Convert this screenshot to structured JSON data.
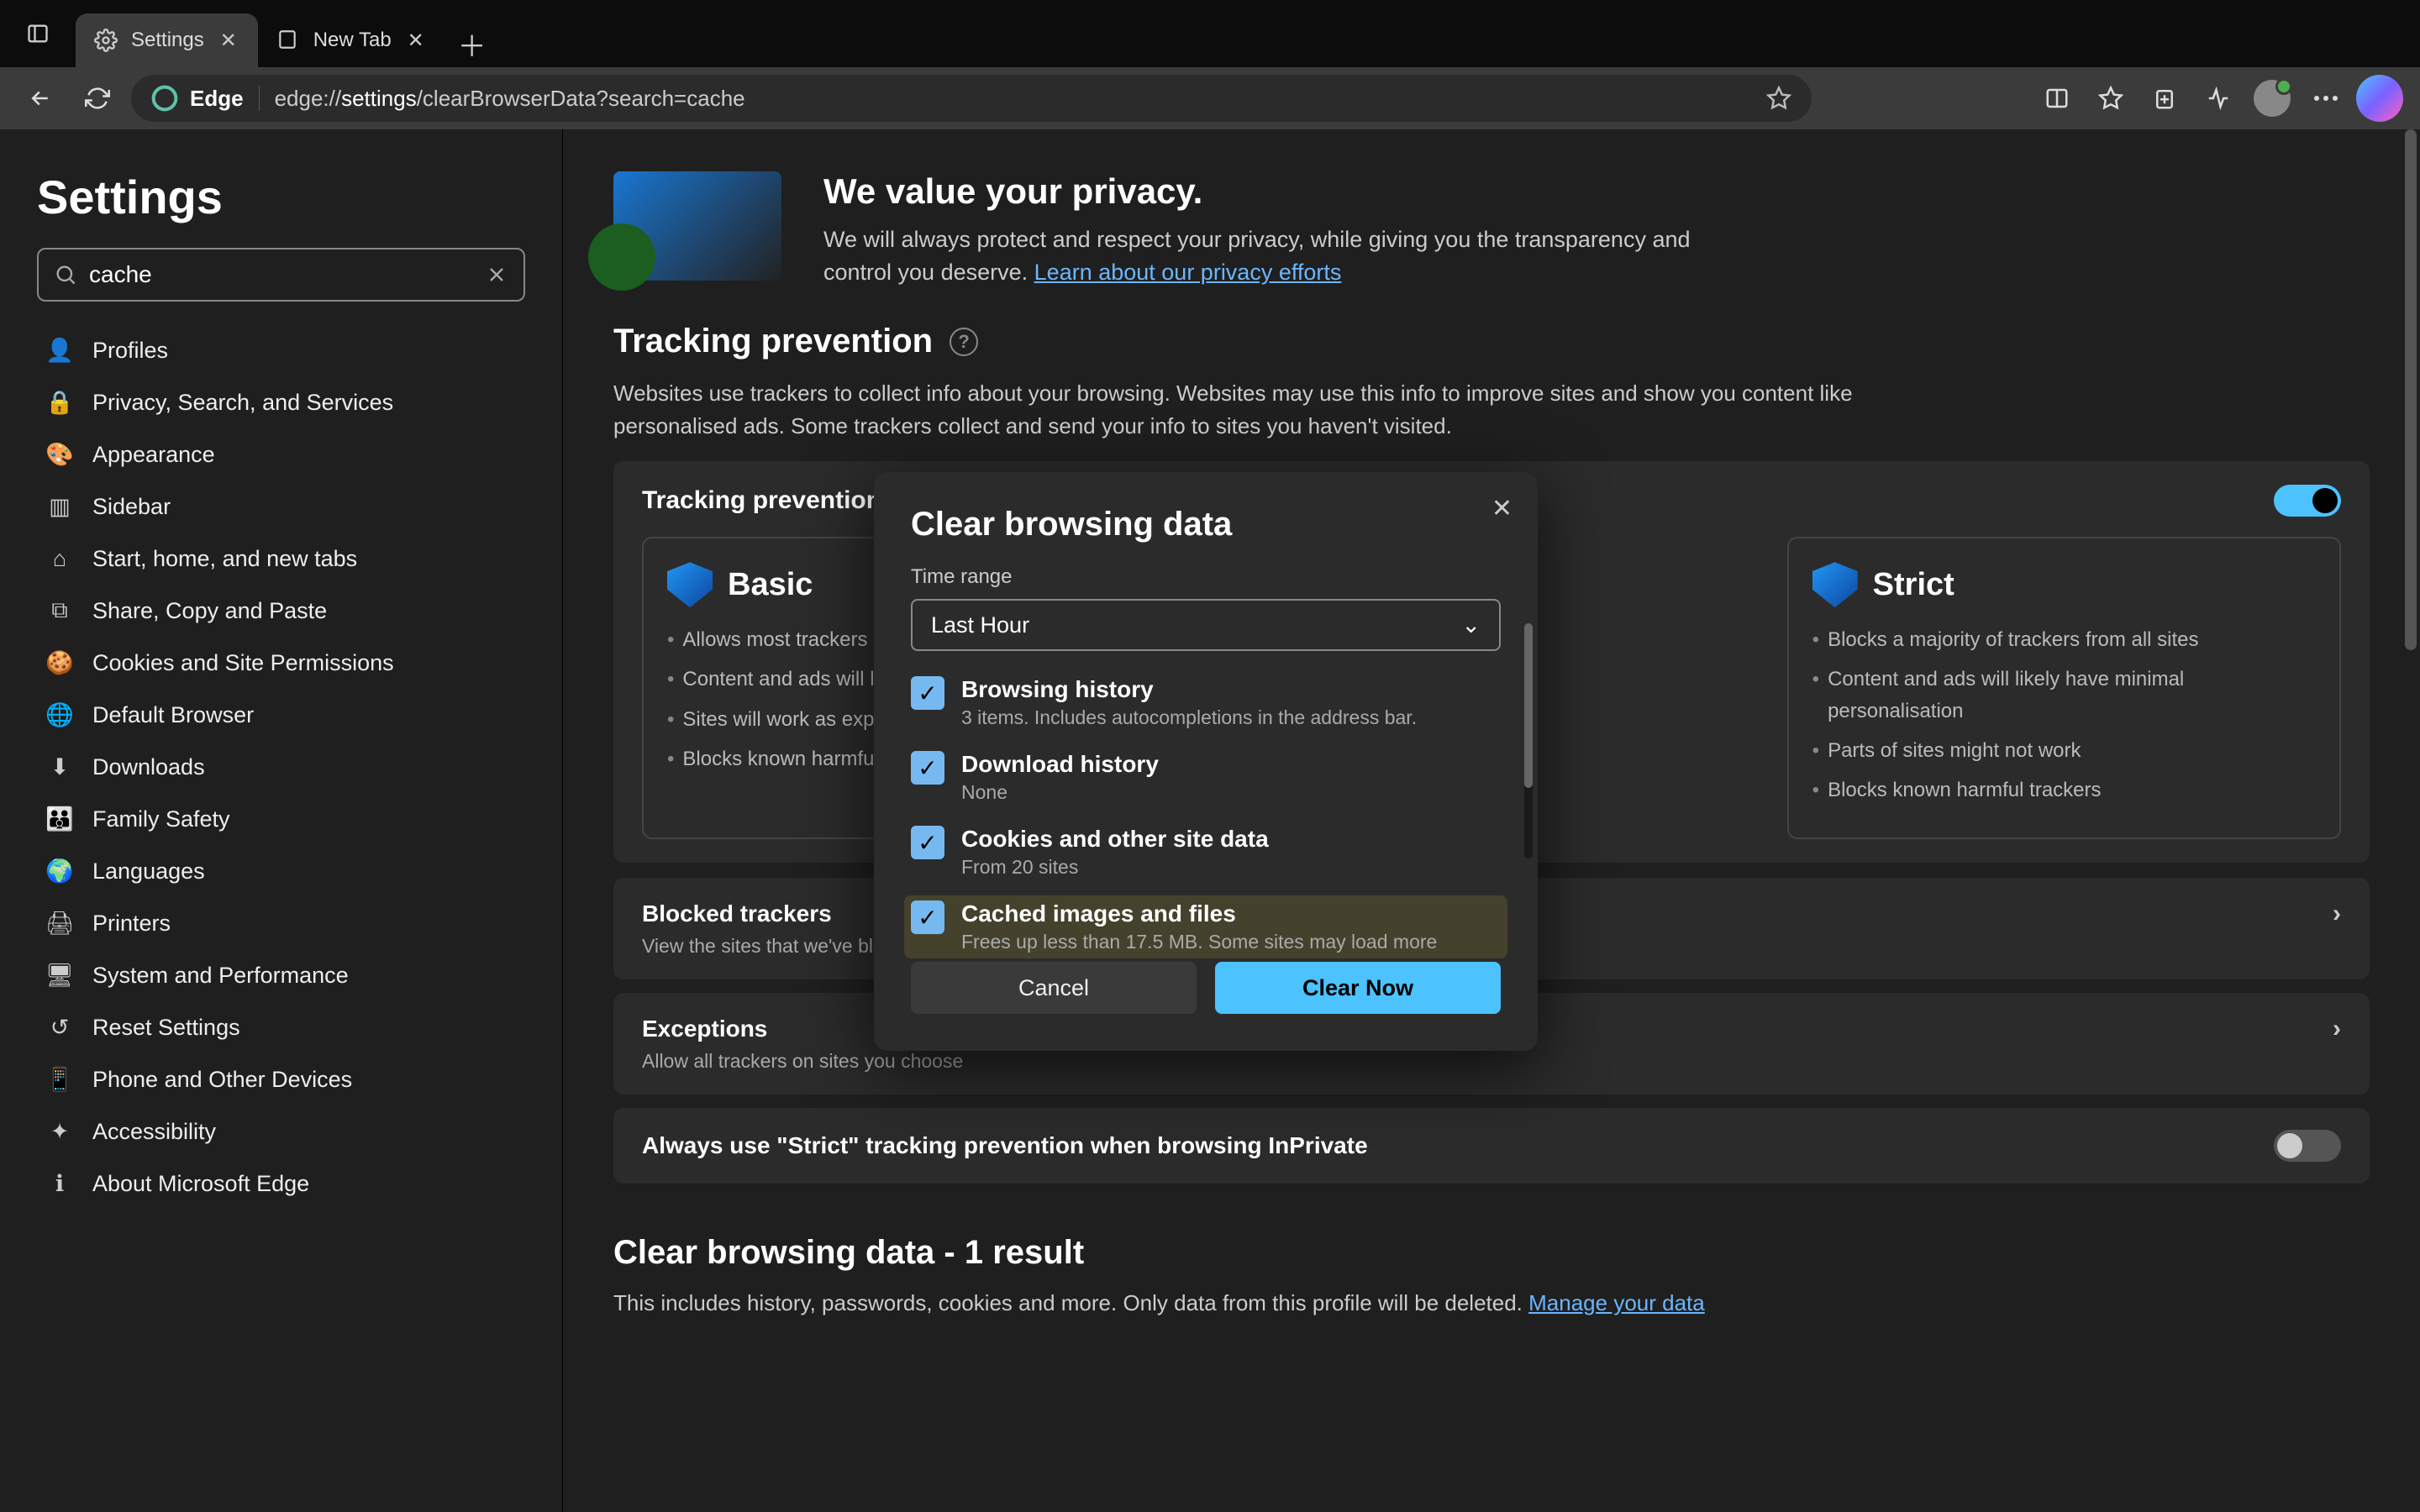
{
  "window": {
    "tabs": [
      {
        "label": "Settings",
        "active": true
      },
      {
        "label": "New Tab",
        "active": false
      }
    ]
  },
  "addressbar": {
    "brand": "Edge",
    "url_prefix": "edge://",
    "url_hl": "settings",
    "url_suffix": "/clearBrowserData?search=cache"
  },
  "sidebar": {
    "title": "Settings",
    "search_value": "cache",
    "items": [
      "Profiles",
      "Privacy, Search, and Services",
      "Appearance",
      "Sidebar",
      "Start, home, and new tabs",
      "Share, Copy and Paste",
      "Cookies and Site Permissions",
      "Default Browser",
      "Downloads",
      "Family Safety",
      "Languages",
      "Printers",
      "System and Performance",
      "Reset Settings",
      "Phone and Other Devices",
      "Accessibility",
      "About Microsoft Edge"
    ]
  },
  "hero": {
    "title": "We value your privacy.",
    "body": "We will always protect and respect your privacy, while giving you the transparency and control you deserve.",
    "link": "Learn about our privacy efforts"
  },
  "tracking": {
    "heading": "Tracking prevention",
    "desc": "Websites use trackers to collect info about your browsing. Websites may use this info to improve sites and show you content like personalised ads. Some trackers collect and send your info to sites you haven't visited.",
    "switch_label": "Tracking prevention",
    "levels": {
      "basic": {
        "title": "Basic",
        "items": [
          "Allows most trackers across all sites",
          "Content and ads will likely be personalised",
          "Sites will work as expected",
          "Blocks known harmful trackers"
        ]
      },
      "strict": {
        "title": "Strict",
        "items": [
          "Blocks a majority of trackers from all sites",
          "Content and ads will likely have minimal personalisation",
          "Parts of sites might not work",
          "Blocks known harmful trackers"
        ]
      }
    },
    "blocked": {
      "title": "Blocked trackers",
      "sub": "View the sites that we've blocked from tracking you"
    },
    "exceptions": {
      "title": "Exceptions",
      "sub": "Allow all trackers on sites you choose"
    },
    "inprivate": "Always use \"Strict\" tracking prevention when browsing InPrivate"
  },
  "clear_section": {
    "title": "Clear browsing data - 1 result",
    "desc": "This includes history, passwords, cookies and more. Only data from this profile will be deleted.",
    "link": "Manage your data"
  },
  "dialog": {
    "title": "Clear browsing data",
    "time_label": "Time range",
    "time_value": "Last Hour",
    "items": [
      {
        "title": "Browsing history",
        "sub": "3 items. Includes autocompletions in the address bar.",
        "checked": true
      },
      {
        "title": "Download history",
        "sub": "None",
        "checked": true
      },
      {
        "title": "Cookies and other site data",
        "sub": "From 20 sites",
        "checked": true
      },
      {
        "title": "Cached images and files",
        "sub": "Frees up less than 17.5 MB. Some sites may load more",
        "checked": true,
        "highlight": true
      }
    ],
    "cancel": "Cancel",
    "clear": "Clear Now"
  }
}
